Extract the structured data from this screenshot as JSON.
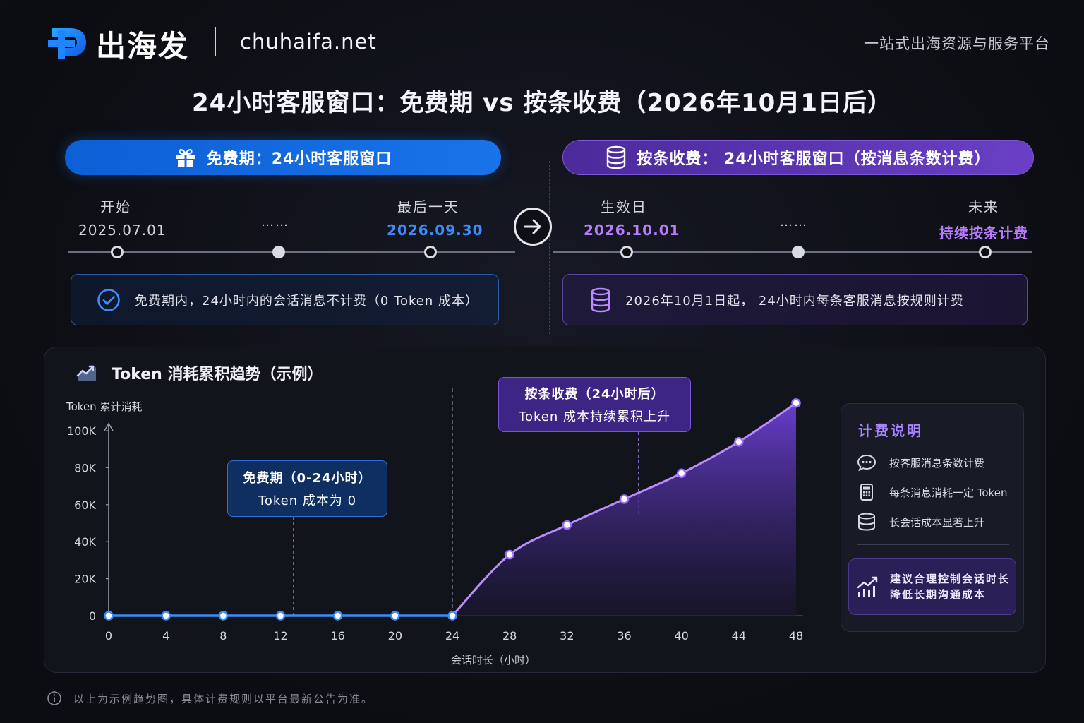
{
  "header": {
    "brand": "出海发",
    "domain": "chuhaifa.net",
    "slogan": "一站式出海资源与服务平台",
    "title": "24小时客服窗口：免费期 vs 按条收费（2026年10月1日后）"
  },
  "free_phase": {
    "banner": "免费期：24小时客服窗口",
    "start_label": "开始",
    "start_date": "2025.07.01",
    "ellipsis": "……",
    "end_label": "最后一天",
    "end_date": "2026.09.30",
    "info": "免费期内，24小时内的会话消息不计费（0 Token 成本）",
    "icon": "gift-icon",
    "accent": "#1a73e8"
  },
  "paid_phase": {
    "banner": "按条收费：  24小时客服窗口（按消息条数计费）",
    "start_label": "生效日",
    "start_date": "2026.10.01",
    "ellipsis": "……",
    "future_label": "未来",
    "future_text": "持续按条计费",
    "info": "2026年10月1日起，  24小时内每条客服消息按规则计费",
    "icon": "database-icon",
    "accent": "#6a3fc6"
  },
  "chart_data": {
    "type": "area",
    "title": "Token 消耗累积趋势（示例）",
    "ylabel": "Token 累计消耗",
    "xlabel": "会话时长（小时）",
    "x_ticks": [
      "0",
      "4",
      "8",
      "12",
      "16",
      "20",
      "24",
      "28",
      "32",
      "36",
      "40",
      "44",
      "48"
    ],
    "y_ticks": [
      "0",
      "20K",
      "40K",
      "60K",
      "80K",
      "100K"
    ],
    "xlim": [
      0,
      48
    ],
    "ylim": [
      0,
      100000
    ],
    "series": [
      {
        "segment": "free",
        "color": "#3b8cff",
        "x": [
          0,
          4,
          8,
          12,
          16,
          20,
          24
        ],
        "y": [
          0,
          0,
          0,
          0,
          0,
          0,
          0
        ]
      },
      {
        "segment": "paid",
        "color": "#b98cff",
        "x": [
          24,
          28,
          32,
          36,
          40,
          44,
          48
        ],
        "y": [
          0,
          33000,
          49000,
          63000,
          77000,
          94000,
          115000
        ]
      }
    ],
    "divider_x": 24,
    "annotations": [
      {
        "line1": "免费期（0-24小时）",
        "line2": "Token 成本为 0",
        "x": 12.9
      },
      {
        "line1": "按条收费（24小时后）",
        "line2": "Token 成本持续累积上升",
        "x": 37
      }
    ]
  },
  "billing": {
    "title": "计费说明",
    "items": [
      {
        "icon": "chat-icon",
        "text": "按客服消息条数计费"
      },
      {
        "icon": "calculator-icon",
        "text": "每条消息消耗一定 Token"
      },
      {
        "icon": "database-icon",
        "text": "长会话成本显著上升"
      }
    ],
    "tip_line1": "建议合理控制会话时长",
    "tip_line2": "降低长期沟通成本"
  },
  "footnote": "以上为示例趋势图，具体计费规则以平台最新公告为准。"
}
